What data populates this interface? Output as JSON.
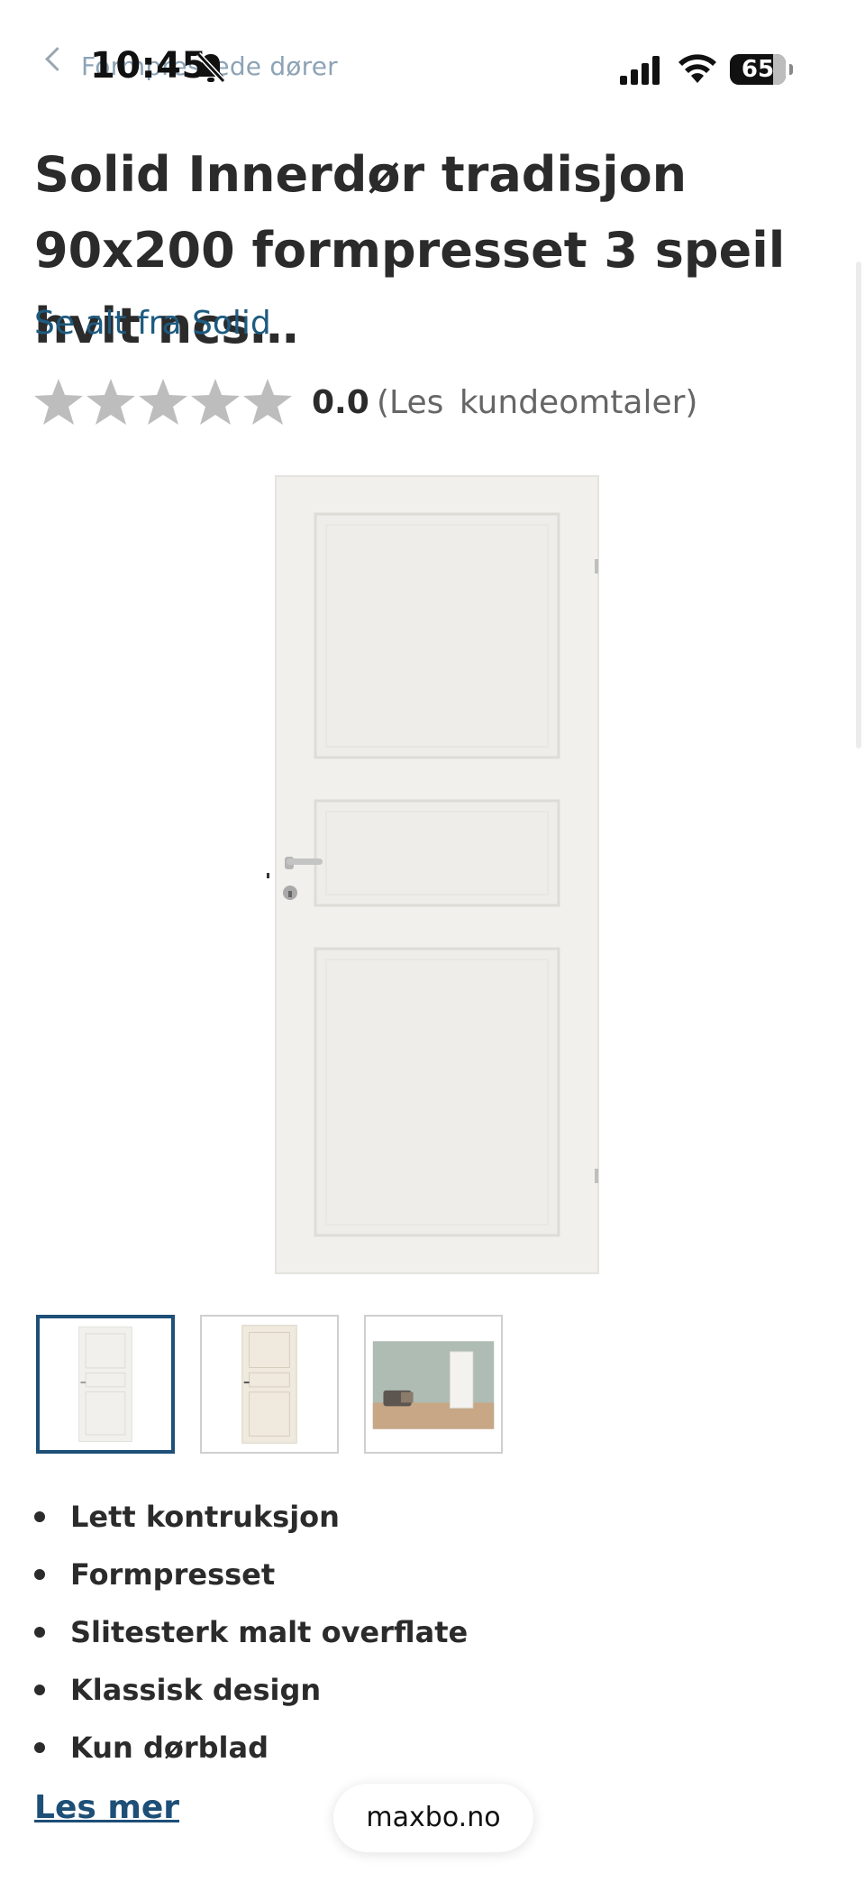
{
  "status_bar": {
    "time": "10:45",
    "battery": "65",
    "breadcrumb": "Formpressede dører"
  },
  "product": {
    "title": "Solid Innerdør tradisjon 90x200 formpresset 3 speil hvit ncs…",
    "brand_link": "Se alt fra Solid",
    "rating": {
      "value": "0.0",
      "reviews_link": "(Les kundeomtaler)",
      "stars_filled": 0,
      "stars_total": 5
    },
    "features": [
      "Lett kontruksjon",
      "Formpresset",
      "Slitesterk malt overflate",
      "Klassisk design",
      "Kun dørblad"
    ],
    "read_more": "Les mer"
  },
  "browser": {
    "url": "maxbo.no"
  },
  "colors": {
    "link": "#1d5b80",
    "active_thumb_border": "#1d4f77",
    "star_empty": "#bdbdbd"
  }
}
